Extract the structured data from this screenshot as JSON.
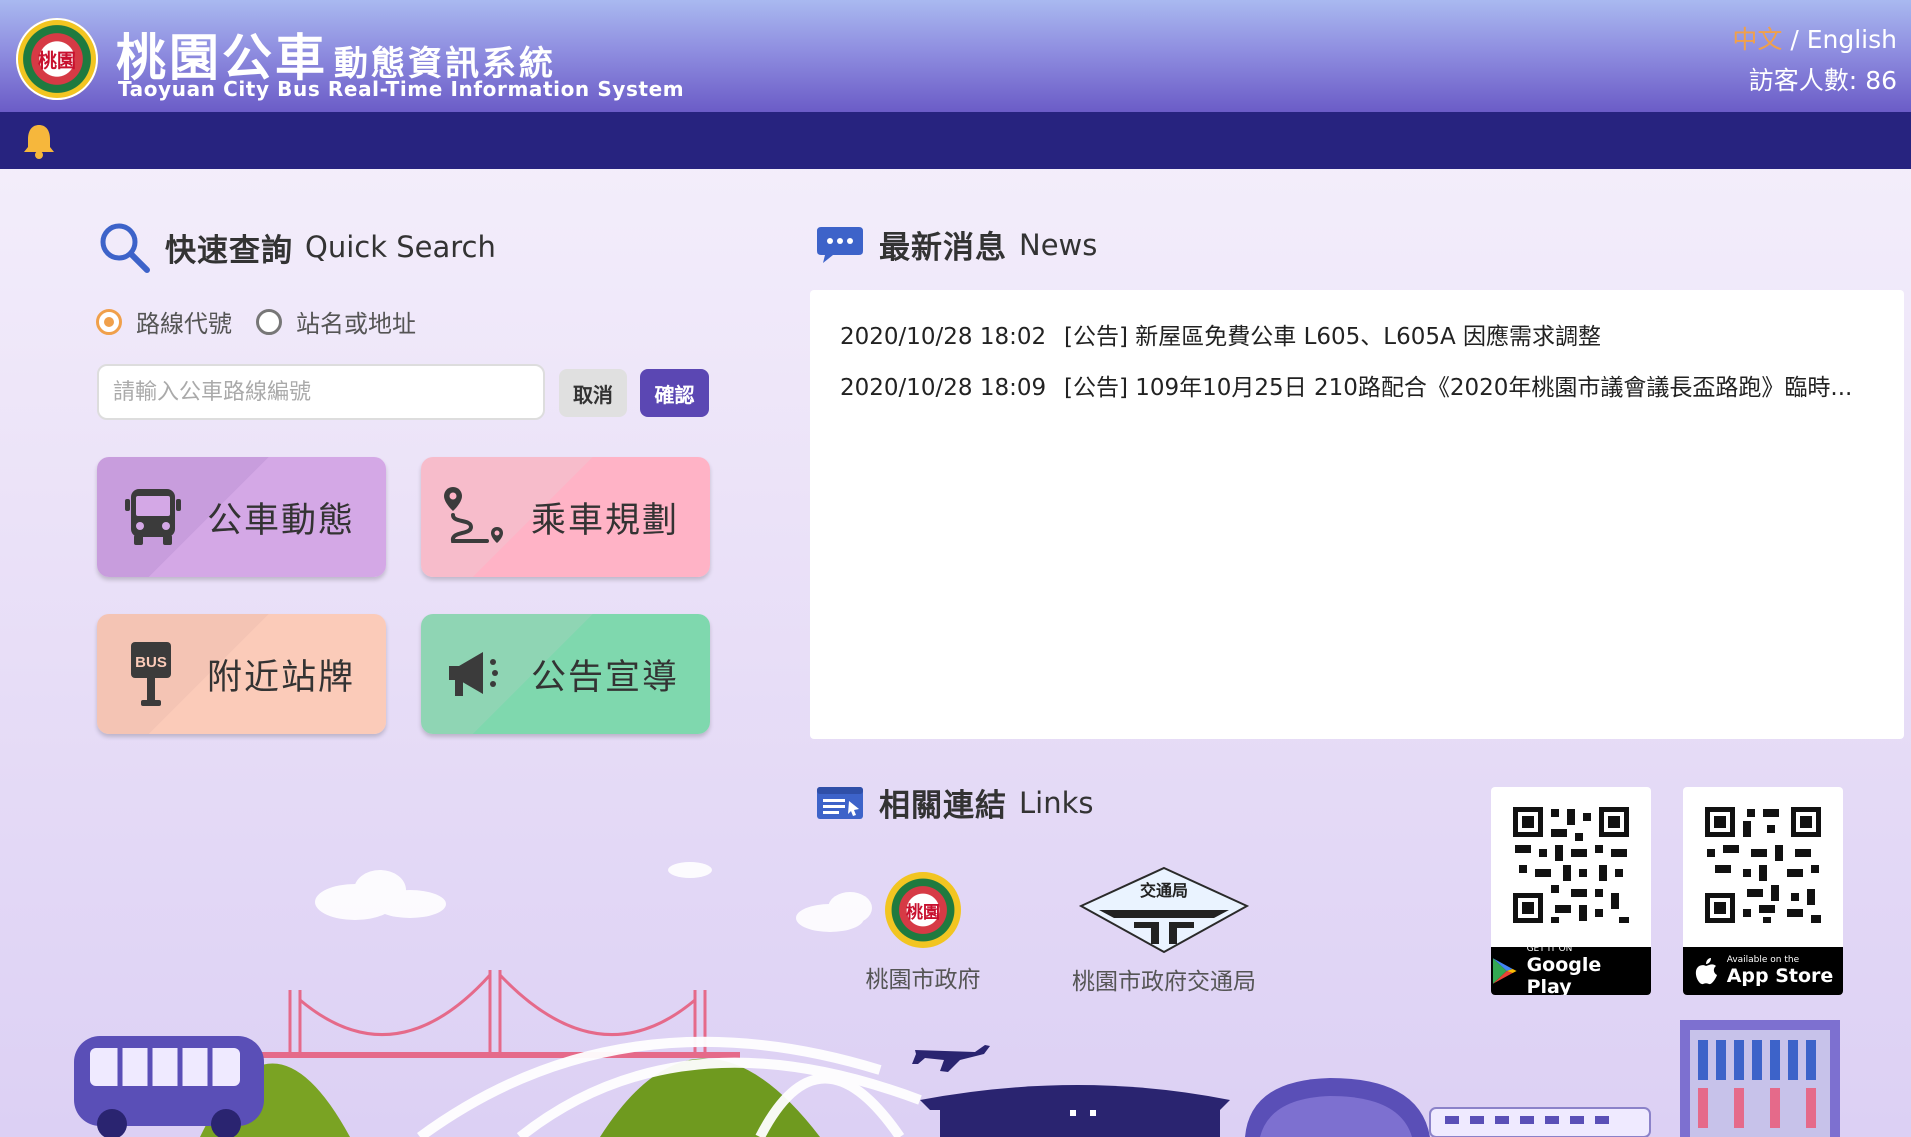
{
  "header": {
    "title_zh_main": "桃園公車",
    "title_zh_sub": "動態資訊系統",
    "title_en": "Taoyuan City Bus Real-Time Information System",
    "logo_text": "桃園",
    "lang_zh": "中文",
    "lang_separator": "/",
    "lang_en": "English",
    "visitor_label": "訪客人數:",
    "visitor_count": "86"
  },
  "navbar": {
    "bell_icon": "bell-icon"
  },
  "quick_search": {
    "title_zh": "快速查詢",
    "title_en": "Quick Search",
    "radio_route": "路線代號",
    "radio_stop": "站名或地址",
    "selected_radio": "路線代號",
    "input_placeholder": "請輸入公車路線編號",
    "input_value": "",
    "cancel_label": "取消",
    "confirm_label": "確認",
    "tiles": [
      {
        "label": "公車動態",
        "icon": "bus-icon",
        "color": "#d4a8e6"
      },
      {
        "label": "乘車規劃",
        "icon": "route-pin-icon",
        "color": "#ffb3c6"
      },
      {
        "label": "附近站牌",
        "icon": "bus-stop-sign-icon",
        "color": "#fbcbb9"
      },
      {
        "label": "公告宣導",
        "icon": "megaphone-icon",
        "color": "#7fd8ae"
      }
    ]
  },
  "news": {
    "title_zh": "最新消息",
    "title_en": "News",
    "items": [
      {
        "date": "2020/10/28 18:02",
        "text": "[公告] 新屋區免費公車 L605、L605A 因應需求調整"
      },
      {
        "date": "2020/10/28 18:09",
        "text": "[公告] 109年10月25日 210路配合《2020年桃園市議會議長盃路跑》臨時..."
      }
    ]
  },
  "links": {
    "title_zh": "相關連結",
    "title_en": "Links",
    "items": [
      {
        "label": "桃園市政府",
        "logo_text": "桃園"
      },
      {
        "label": "桃園市政府交通局",
        "logo_text": "交通局"
      }
    ],
    "apps": [
      {
        "store_small": "GET IT ON",
        "store_big": "Google Play",
        "icon": "google-play-icon"
      },
      {
        "store_small": "Available on the",
        "store_big": "App Store",
        "icon": "apple-icon"
      }
    ]
  },
  "colors": {
    "header_top": "#a9b9f0",
    "header_bottom": "#6b5cc7",
    "navbar": "#27237f",
    "accent_orange": "#f0a04b",
    "confirm_button": "#5b47b3"
  }
}
